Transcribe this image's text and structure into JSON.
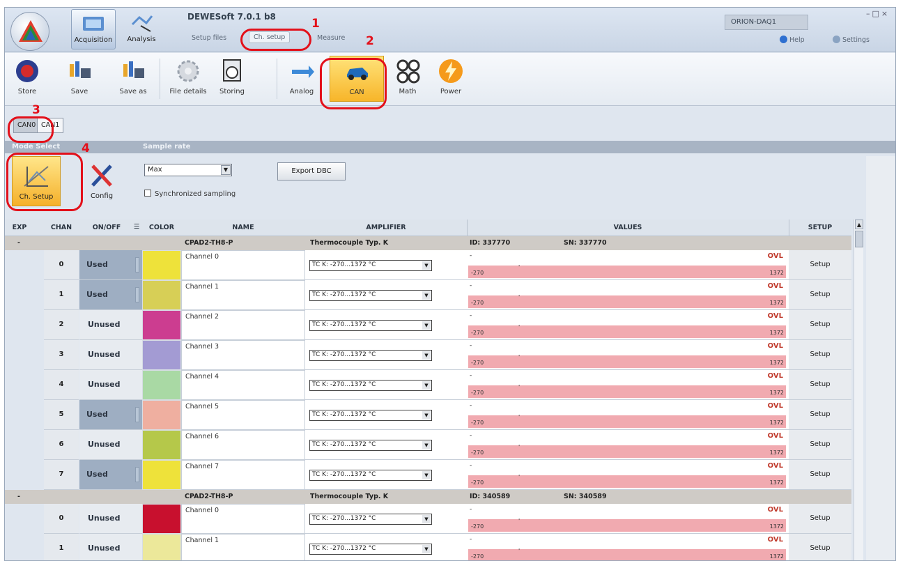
{
  "app": {
    "title": "DEWESoft 7.0.1 b8",
    "device": "ORION-DAQ1",
    "help": "Help",
    "settings": "Settings"
  },
  "modes": [
    {
      "label": "Acquisition"
    },
    {
      "label": "Analysis"
    }
  ],
  "subtabs": [
    {
      "label": "Setup files"
    },
    {
      "label": "Ch. setup"
    },
    {
      "label": "Measure"
    }
  ],
  "toolbar": {
    "store": "Store",
    "save": "Save",
    "save_as": "Save as",
    "file_details": "File details",
    "storing": "Storing",
    "analog": "Analog",
    "can": "CAN",
    "math": "Math",
    "power": "Power"
  },
  "can_tabs": [
    "CAN0",
    "CAN1"
  ],
  "section": {
    "mode_select": "Mode Select",
    "sample_rate": "Sample rate"
  },
  "mode_buttons": {
    "ch_setup": "Ch. Setup",
    "config": "Config"
  },
  "sample_rate": {
    "value": "Max",
    "sync_label": "Synchronized sampling"
  },
  "export_dbc": "Export DBC",
  "columns": {
    "exp": "EXP",
    "chan": "CHAN",
    "onoff": "ON/OFF",
    "color": "COLOR",
    "name": "NAME",
    "amplifier": "AMPLIFIER",
    "values": "VALUES",
    "setup": "SETUP"
  },
  "groups": [
    {
      "expand": "-",
      "module": "CPAD2-TH8-P",
      "amplifier": "Thermocouple Typ. K",
      "id": "ID: 337770",
      "sn": "SN: 337770",
      "rows": [
        {
          "chan": "0",
          "state": "Used",
          "color": "#eee23a",
          "name": "Channel 0",
          "amp": "TC K: -270...1372 °C",
          "ovl": "OVL",
          "lo": "-270",
          "hi": "1372",
          "setup": "Setup"
        },
        {
          "chan": "1",
          "state": "Used",
          "color": "#d7cf56",
          "name": "Channel 1",
          "amp": "TC K: -270...1372 °C",
          "ovl": "OVL",
          "lo": "-270",
          "hi": "1372",
          "setup": "Setup"
        },
        {
          "chan": "2",
          "state": "Unused",
          "color": "#cc3d90",
          "name": "Channel 2",
          "amp": "TC K: -270...1372 °C",
          "ovl": "OVL",
          "lo": "-270",
          "hi": "1372",
          "setup": "Setup"
        },
        {
          "chan": "3",
          "state": "Unused",
          "color": "#a39bd3",
          "name": "Channel 3",
          "amp": "TC K: -270...1372 °C",
          "ovl": "OVL",
          "lo": "-270",
          "hi": "1372",
          "setup": "Setup"
        },
        {
          "chan": "4",
          "state": "Unused",
          "color": "#a9d9a4",
          "name": "Channel 4",
          "amp": "TC K: -270...1372 °C",
          "ovl": "OVL",
          "lo": "-270",
          "hi": "1372",
          "setup": "Setup"
        },
        {
          "chan": "5",
          "state": "Used",
          "color": "#efafa0",
          "name": "Channel 5",
          "amp": "TC K: -270...1372 °C",
          "ovl": "OVL",
          "lo": "-270",
          "hi": "1372",
          "setup": "Setup"
        },
        {
          "chan": "6",
          "state": "Unused",
          "color": "#b5c84a",
          "name": "Channel 6",
          "amp": "TC K: -270...1372 °C",
          "ovl": "OVL",
          "lo": "-270",
          "hi": "1372",
          "setup": "Setup"
        },
        {
          "chan": "7",
          "state": "Used",
          "color": "#eee23a",
          "name": "Channel 7",
          "amp": "TC K: -270...1372 °C",
          "ovl": "OVL",
          "lo": "-270",
          "hi": "1372",
          "setup": "Setup"
        }
      ]
    },
    {
      "expand": "-",
      "module": "CPAD2-TH8-P",
      "amplifier": "Thermocouple Typ. K",
      "id": "ID: 340589",
      "sn": "SN: 340589",
      "rows": [
        {
          "chan": "0",
          "state": "Unused",
          "color": "#c8102e",
          "name": "Channel 0",
          "amp": "TC K: -270...1372 °C",
          "ovl": "OVL",
          "lo": "-270",
          "hi": "1372",
          "setup": "Setup"
        },
        {
          "chan": "1",
          "state": "Unused",
          "color": "#ece89a",
          "name": "Channel 1",
          "amp": "TC K: -270...1372 °C",
          "ovl": "OVL",
          "lo": "-270",
          "hi": "1372",
          "setup": "Setup"
        }
      ]
    }
  ],
  "annotations": [
    "1",
    "2",
    "3",
    "4"
  ]
}
